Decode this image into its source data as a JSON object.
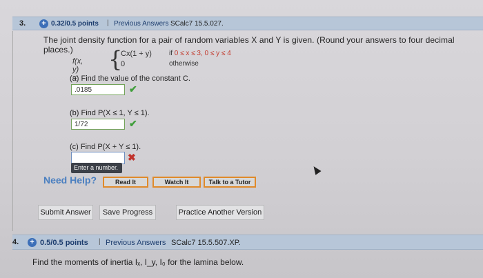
{
  "q3": {
    "number": "3.",
    "points": "0.32/0.5 points",
    "separator": "|",
    "previous": "Previous Answers",
    "source": "SCalc7 15.5.027.",
    "intro": "The joint density function for a pair of random variables X and Y is given. (Round your answers to four decimal places.)",
    "formula": {
      "lhs": "f(x, y) =",
      "case1_expr": "Cx(1 + y)",
      "case1_cond_prefix": "if ",
      "case1_cond_red": "0 ≤ x ≤ 3, 0 ≤ y ≤ 4",
      "case2_expr": "0",
      "case2_cond": "otherwise"
    },
    "part_a": {
      "label": "(a) Find the value of the constant C.",
      "value": ".0185",
      "status": "correct"
    },
    "part_b": {
      "label": "(b) Find P(X ≤ 1, Y ≤ 1).",
      "value": "1/72",
      "status": "correct"
    },
    "part_c": {
      "label": "(c) Find P(X + Y ≤ 1).",
      "value": "",
      "status": "incorrect",
      "tooltip": "Enter a number."
    },
    "help": {
      "label": "Need Help?",
      "read": "Read It",
      "watch": "Watch It",
      "tutor": "Talk to a Tutor"
    },
    "actions": {
      "submit": "Submit Answer",
      "save": "Save Progress",
      "practice": "Practice Another Version"
    }
  },
  "q4": {
    "number": "4.",
    "points": "0.5/0.5 points",
    "separator": "|",
    "previous": "Previous Answers",
    "source": "SCalc7 15.5.507.XP.",
    "intro": "Find the moments of inertia Iₓ, I_y, I₀ for the lamina below."
  },
  "colors": {
    "correct": "#3f9e3a",
    "incorrect": "#c0322b",
    "help_border": "#e08a2a",
    "header_bar": "#b7c6d8"
  }
}
